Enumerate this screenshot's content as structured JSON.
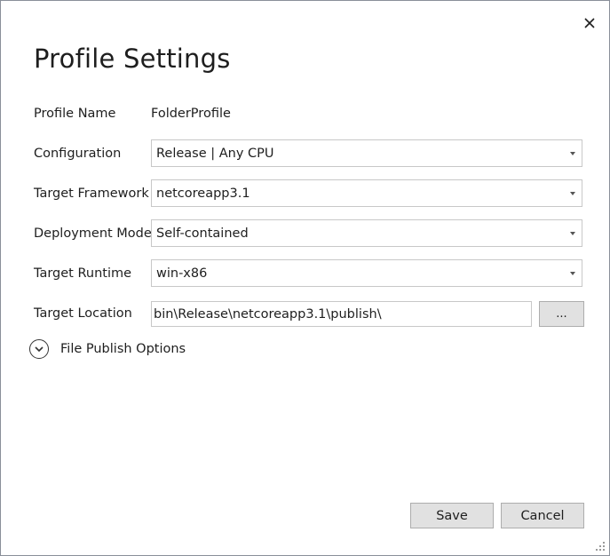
{
  "dialog": {
    "title": "Profile Settings",
    "close_icon": "close-icon"
  },
  "profile_name": {
    "label": "Profile Name",
    "value": "FolderProfile"
  },
  "configuration": {
    "label": "Configuration",
    "value": "Release | Any CPU"
  },
  "target_framework": {
    "label": "Target Framework",
    "value": "netcoreapp3.1"
  },
  "deployment_mode": {
    "label": "Deployment Mode",
    "value": "Self-contained"
  },
  "target_runtime": {
    "label": "Target Runtime",
    "value": "win-x86"
  },
  "target_location": {
    "label": "Target Location",
    "value": "bin\\Release\\netcoreapp3.1\\publish\\",
    "browse_label": "..."
  },
  "file_publish_options": {
    "label": "File Publish Options",
    "icon": "chevron-down-circle-icon",
    "expanded": false
  },
  "footer": {
    "save_label": "Save",
    "cancel_label": "Cancel"
  },
  "colors": {
    "button_bg": "#e1e1e1",
    "button_border": "#adadad",
    "field_border": "#c8c8c8",
    "dialog_border": "#8a8f99"
  }
}
